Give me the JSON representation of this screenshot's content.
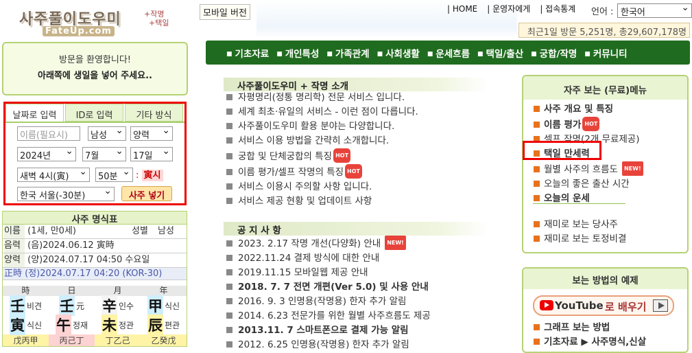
{
  "logo": {
    "title": "사주풀이도우미",
    "sub1": "+작명",
    "sub2": "+택일",
    "site": "FateUp.com"
  },
  "top": {
    "mobile": "모바일 버전",
    "links": [
      "| HOME",
      "| 운영자에게",
      "| 접속통계"
    ],
    "lang_label": "언어 :",
    "lang_value": "한국어",
    "counter": "최근1일 방문 5,251명, 총29,607,178명"
  },
  "nav": [
    "기초자료",
    "개인특성",
    "가족관계",
    "사회생활",
    "운세흐름",
    "택일/출산",
    "궁합/작명",
    "커뮤니티"
  ],
  "welcome": {
    "line1": "방문을 환영합니다!",
    "line2": "아래쪽에 생일을 넣어 주세요.."
  },
  "input": {
    "tabs": [
      "날짜로 입력",
      "ID로 입력",
      "기타 방식"
    ],
    "name_placeholder": "이름(필요시)",
    "gender": "남성",
    "calendar": "양력",
    "year": "2024년",
    "month": "7월",
    "day": "17일",
    "hour": "새벽 4시(寅)",
    "minute": "50분",
    "ganji_prefix": ":",
    "ganji": "寅시",
    "location": "한국 서울(-30분)",
    "submit": "사주 넣기"
  },
  "myungsik": {
    "title": "사주 명식표",
    "name_label": "이름",
    "name_value": "(1세, 만0세)",
    "gender_label": "성별",
    "gender_value": "남성",
    "lunar_label": "음력",
    "lunar_value": "(음)2024.06.12 寅時",
    "solar_label": "양력",
    "solar_value": "(양)2024.07.17 04:50 수요일",
    "corrected": "正時 (정)2024.07.17 04:20 (KOR-30)",
    "pillars": [
      {
        "head": "時",
        "stem": "壬",
        "stem_god": "비견",
        "branch": "寅",
        "branch_god": "식신",
        "hidden": "戊丙甲"
      },
      {
        "head": "日",
        "stem": "壬",
        "stem_god": "元",
        "branch": "午",
        "branch_god": "정재",
        "hidden": "丙己丁"
      },
      {
        "head": "月",
        "stem": "辛",
        "stem_god": "인수",
        "branch": "未",
        "branch_god": "정관",
        "hidden": "丁乙己"
      },
      {
        "head": "年",
        "stem": "甲",
        "stem_god": "식신",
        "branch": "辰",
        "branch_god": "편관",
        "hidden": "乙癸戊"
      }
    ]
  },
  "intro": {
    "title": "사주풀이도우미 + 작명 소개",
    "items": [
      {
        "text": "자평명리(정통 명리학) 전문 서비스 입니다.",
        "hot": ""
      },
      {
        "text": "세계 최초·유일의 서비스 - 이런 점이 다릅니다.",
        "hot": ""
      },
      {
        "text": "사주풀이도우미 활용 분야는 다양합니다.",
        "hot": ""
      },
      {
        "text": "서비스 이용 방법을 간략히 소개합니다.",
        "hot": ""
      },
      {
        "text": "궁합 및 단체궁합의 특징",
        "hot": "HOT"
      },
      {
        "text": "이름 평가/셀프 작명의 특징",
        "hot": "HOT"
      },
      {
        "text": "서비스 이용시 주의할 사항 입니다.",
        "hot": ""
      },
      {
        "text": "서비스 제공 현황 및 업데이트 사항",
        "hot": ""
      }
    ]
  },
  "notice": {
    "title": "공 지 사 항",
    "items": [
      {
        "text": "2023. 2.17 작명 개선(다양화) 안내",
        "new": "NEW!"
      },
      {
        "text": "2022.11.24 결제 방식에 대한 안내",
        "new": ""
      },
      {
        "text": "2019.11.15 모바일웹 제공 안내",
        "new": ""
      },
      {
        "text": "2018. 7. 7 전면 개편(Ver 5.0) 및 사용 안내",
        "new": ""
      },
      {
        "text": "2016. 9. 3 인명용(작명용) 한자 추가 알림",
        "new": ""
      },
      {
        "text": "2014. 6.23 전문가를 위한 월별 사주흐름도 제공",
        "new": ""
      },
      {
        "text": "2013.11. 7 스마트폰으로 결제 가능 알림",
        "new": ""
      },
      {
        "text": "2012. 6.25 인명용(작명용) 한자 추가 알림",
        "new": ""
      }
    ]
  },
  "menu": {
    "title": "자주 보는 (무료)메뉴",
    "items": [
      {
        "text": "사주 개요 및 특징",
        "badge": ""
      },
      {
        "text": "이름 평가",
        "badge": "HOT"
      },
      {
        "text": "셀프 작명(2개 무료제공)",
        "badge": ""
      },
      {
        "text": "택일 만세력",
        "badge": ""
      },
      {
        "text": "월별 사주의 흐름도",
        "badge": "NEW!"
      },
      {
        "text": "오늘의 좋은 출산 시간",
        "badge": ""
      },
      {
        "text": "오늘의 운세",
        "badge": ""
      }
    ],
    "fun": [
      "재미로 보는 당사주",
      "재미로 보는 토정비결"
    ]
  },
  "howto": {
    "title": "보는 방법의 예제",
    "yt_word": "YouTube",
    "yt_text": "로 배우기",
    "items": [
      "그래프 보는 방법",
      "기초자료 ▶ 사주명식,신살"
    ]
  },
  "colors": {
    "nav_bg": "#1f6b1f",
    "panel_border": "#b5d275",
    "highlight": "#ee0000"
  }
}
